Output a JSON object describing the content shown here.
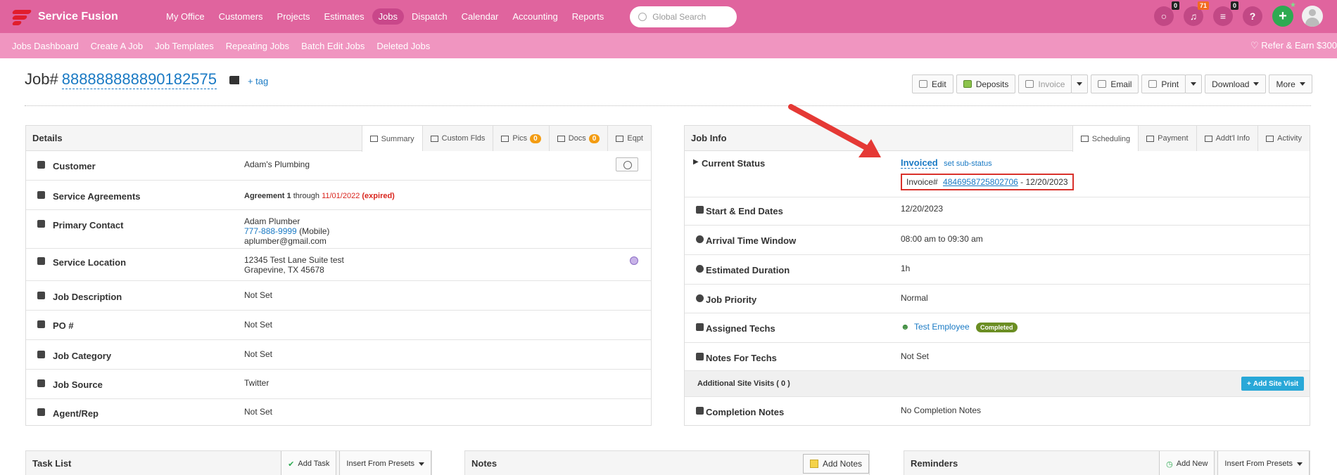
{
  "brand": {
    "name": "Service Fusion",
    "accent": "#e0649e",
    "sub_accent": "#f095c0"
  },
  "nav": {
    "items": [
      "My Office",
      "Customers",
      "Projects",
      "Estimates",
      "Jobs",
      "Dispatch",
      "Calendar",
      "Accounting",
      "Reports"
    ],
    "active": "Jobs"
  },
  "search": {
    "placeholder": "Global Search"
  },
  "top_badges": {
    "messages": "0",
    "notifications": "71",
    "list": "0"
  },
  "subnav": {
    "items": [
      "Jobs Dashboard",
      "Create A Job",
      "Job Templates",
      "Repeating Jobs",
      "Batch Edit Jobs",
      "Deleted Jobs"
    ],
    "refer": "Refer & Earn $300"
  },
  "job": {
    "label": "Job#",
    "number": "888888888890182575",
    "tag_link": "+ tag"
  },
  "actions": {
    "edit": "Edit",
    "deposits": "Deposits",
    "invoice": "Invoice",
    "email": "Email",
    "print": "Print",
    "download": "Download",
    "more": "More"
  },
  "details": {
    "title": "Details",
    "tabs": {
      "summary": "Summary",
      "custom": "Custom Flds",
      "pics": "Pics",
      "pics_count": "0",
      "docs": "Docs",
      "docs_count": "0",
      "eqpt": "Eqpt"
    },
    "customer": {
      "label": "Customer",
      "value": "Adam's Plumbing"
    },
    "agreements": {
      "label": "Service Agreements",
      "name": "Agreement 1",
      "through": "through",
      "date": "11/01/2022",
      "status": "(expired)"
    },
    "contact": {
      "label": "Primary Contact",
      "name": "Adam Plumber",
      "phone": "777-888-9999",
      "phone_type": "(Mobile)",
      "email": "aplumber@gmail.com"
    },
    "location": {
      "label": "Service Location",
      "line1": "12345 Test Lane Suite test",
      "line2": "Grapevine, TX 45678"
    },
    "description": {
      "label": "Job Description",
      "value": "Not Set"
    },
    "po": {
      "label": "PO #",
      "value": "Not Set"
    },
    "category": {
      "label": "Job Category",
      "value": "Not Set"
    },
    "source": {
      "label": "Job Source",
      "value": "Twitter"
    },
    "agent": {
      "label": "Agent/Rep",
      "value": "Not Set"
    }
  },
  "jobinfo": {
    "title": "Job Info",
    "tabs": {
      "scheduling": "Scheduling",
      "payment": "Payment",
      "addtl": "Addt'l Info",
      "activity": "Activity"
    },
    "status": {
      "label": "Current Status",
      "value": "Invoiced",
      "sub": "set sub-status",
      "invoice_label": "Invoice#",
      "invoice_number": "4846958725802706",
      "invoice_date": "- 12/20/2023"
    },
    "dates": {
      "label": "Start & End Dates",
      "value": "12/20/2023"
    },
    "arrival": {
      "label": "Arrival Time Window",
      "value": "08:00 am to 09:30 am"
    },
    "duration": {
      "label": "Estimated Duration",
      "value": "1h"
    },
    "priority": {
      "label": "Job Priority",
      "value": "Normal"
    },
    "techs": {
      "label": "Assigned Techs",
      "name": "Test Employee",
      "badge": "Completed"
    },
    "notes_techs": {
      "label": "Notes For Techs",
      "value": "Not Set"
    },
    "site_visits": {
      "label": "Additional Site Visits ( 0 )",
      "button": "Add Site Visit"
    },
    "completion": {
      "label": "Completion Notes",
      "value": "No Completion Notes"
    }
  },
  "tasks": {
    "title": "Task List",
    "add": "Add Task",
    "presets": "Insert From Presets"
  },
  "notes": {
    "title": "Notes",
    "add": "Add Notes"
  },
  "reminders": {
    "title": "Reminders",
    "add": "Add New",
    "presets": "Insert From Presets"
  }
}
